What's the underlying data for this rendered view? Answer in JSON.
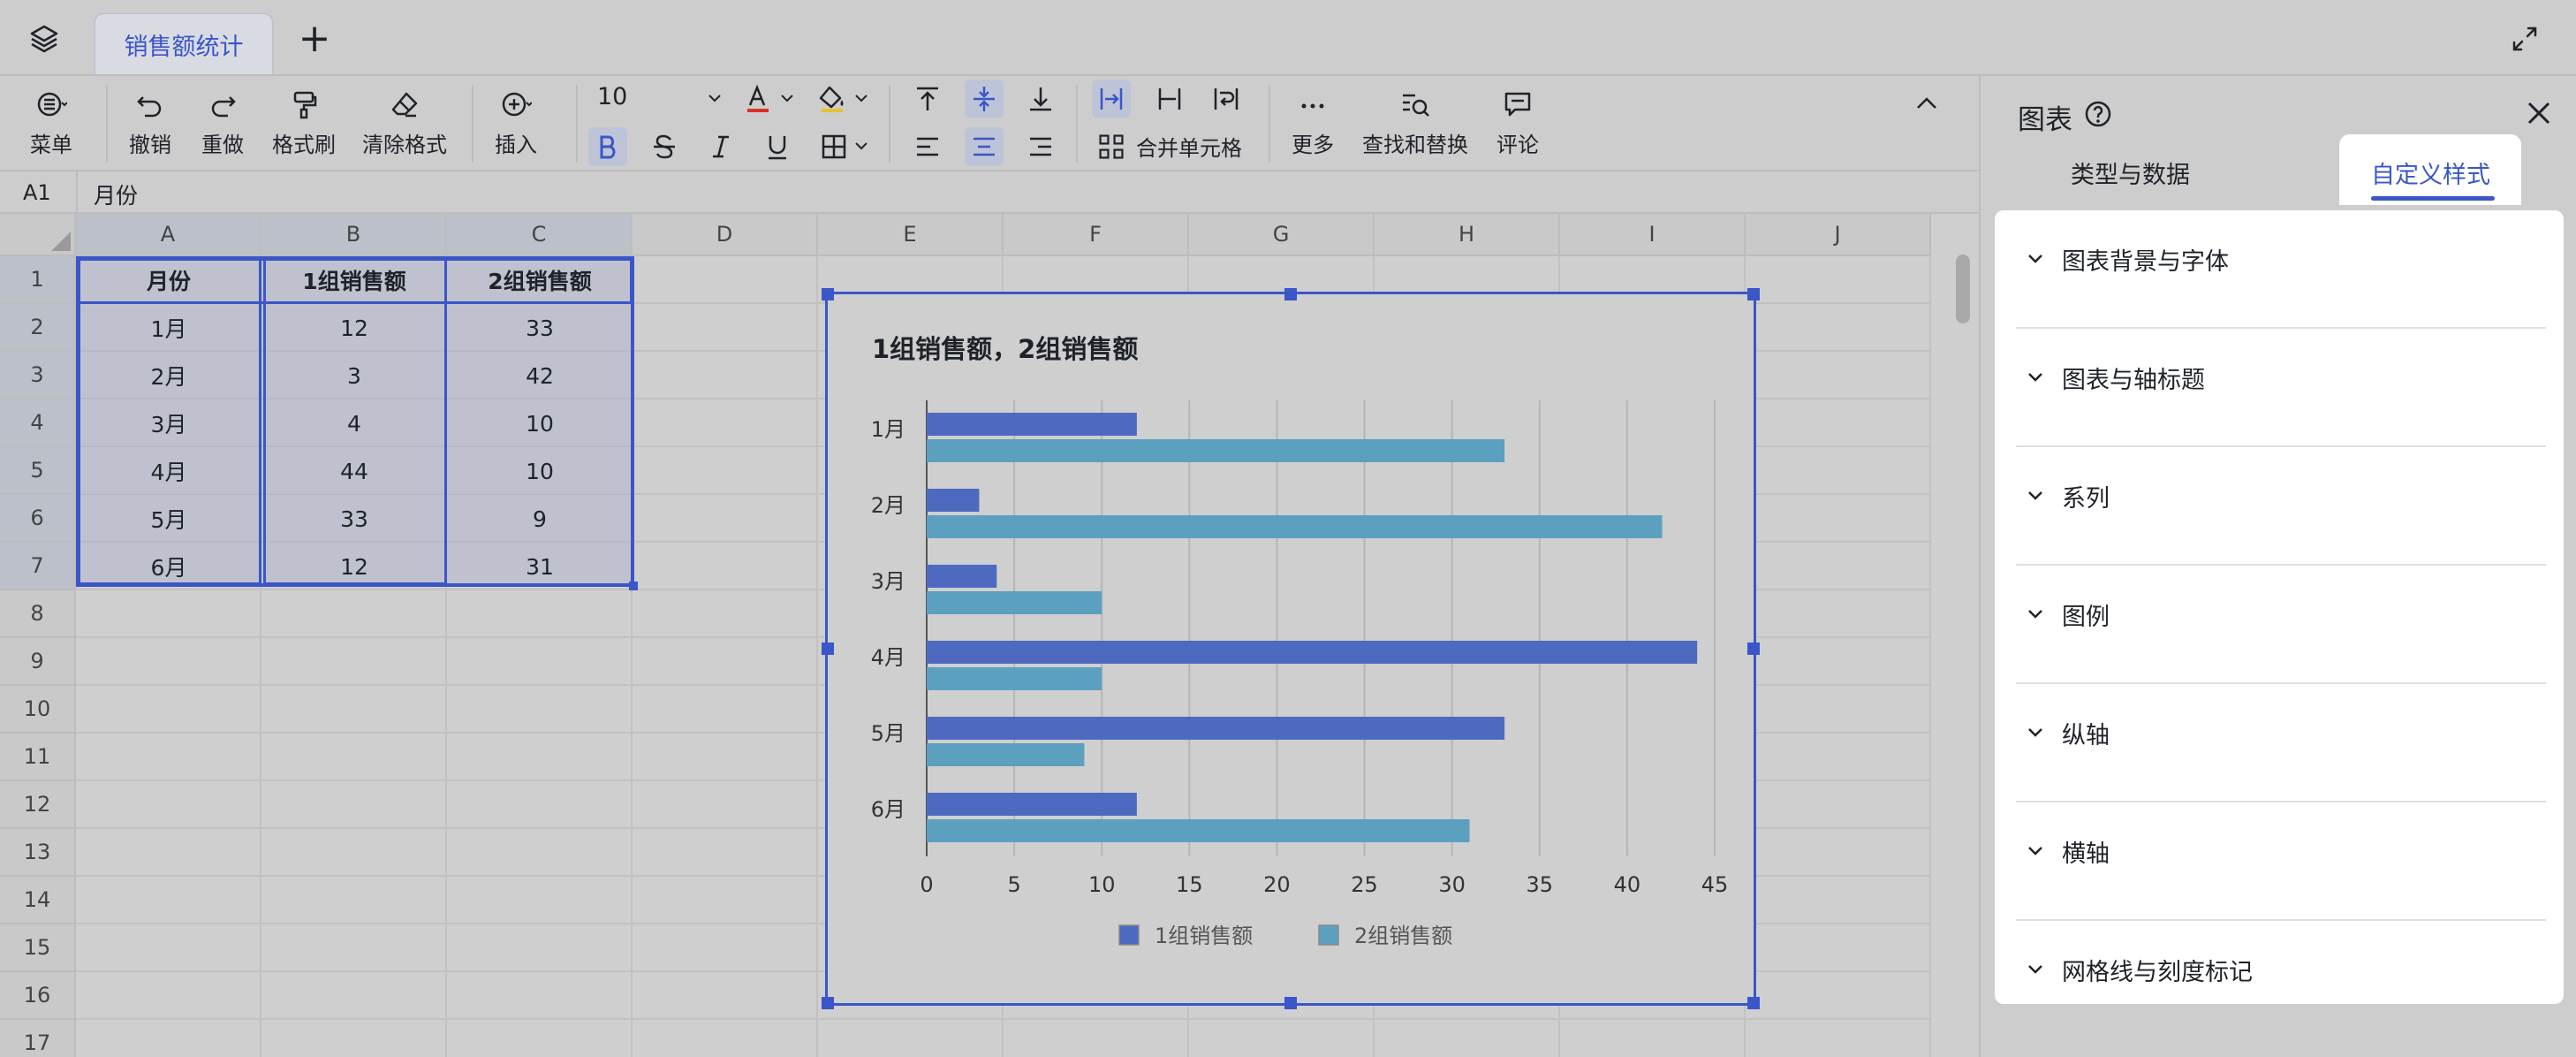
{
  "tabs": {
    "active": "销售额统计",
    "add": "+"
  },
  "toolbar": {
    "menu": "菜单",
    "undo": "撤销",
    "redo": "重做",
    "format_painter": "格式刷",
    "clear_format": "清除格式",
    "insert": "插入",
    "font_size": "10",
    "merge_cells": "合并单元格",
    "more": "更多",
    "find_replace": "查找和替换",
    "comment": "评论"
  },
  "formula_bar": {
    "cell_ref": "A1",
    "value": "月份"
  },
  "grid": {
    "columns": [
      "A",
      "B",
      "C",
      "D",
      "E",
      "F",
      "G",
      "H",
      "I",
      "J"
    ],
    "rows": [
      "1",
      "2",
      "3",
      "4",
      "5",
      "6",
      "7",
      "8",
      "9",
      "10",
      "11",
      "12",
      "13",
      "14",
      "15",
      "16",
      "17"
    ],
    "header": [
      "月份",
      "1组销售额",
      "2组销售额"
    ],
    "data": [
      [
        "1月",
        "12",
        "33"
      ],
      [
        "2月",
        "3",
        "42"
      ],
      [
        "3月",
        "4",
        "10"
      ],
      [
        "4月",
        "44",
        "10"
      ],
      [
        "5月",
        "33",
        "9"
      ],
      [
        "6月",
        "12",
        "31"
      ]
    ]
  },
  "chart_data": {
    "type": "bar",
    "orientation": "horizontal",
    "title": "1组销售额，2组销售额",
    "categories": [
      "1月",
      "2月",
      "3月",
      "4月",
      "5月",
      "6月"
    ],
    "series": [
      {
        "name": "1组销售额",
        "values": [
          12,
          3,
          4,
          44,
          33,
          12
        ],
        "color": "#4e69c0"
      },
      {
        "name": "2组销售额",
        "values": [
          33,
          42,
          10,
          10,
          9,
          31
        ],
        "color": "#5ba0bf"
      }
    ],
    "xticks": [
      "0",
      "5",
      "10",
      "15",
      "20",
      "25",
      "30",
      "35",
      "40",
      "45"
    ],
    "xlim": [
      0,
      45
    ],
    "grid": "vertical",
    "legend": "bottom"
  },
  "panel": {
    "title": "图表",
    "tabs": [
      "类型与数据",
      "自定义样式"
    ],
    "active_tab": "自定义样式",
    "sections": [
      "图表背景与字体",
      "图表与轴标题",
      "系列",
      "图例",
      "纵轴",
      "横轴",
      "网格线与刻度标记"
    ]
  }
}
